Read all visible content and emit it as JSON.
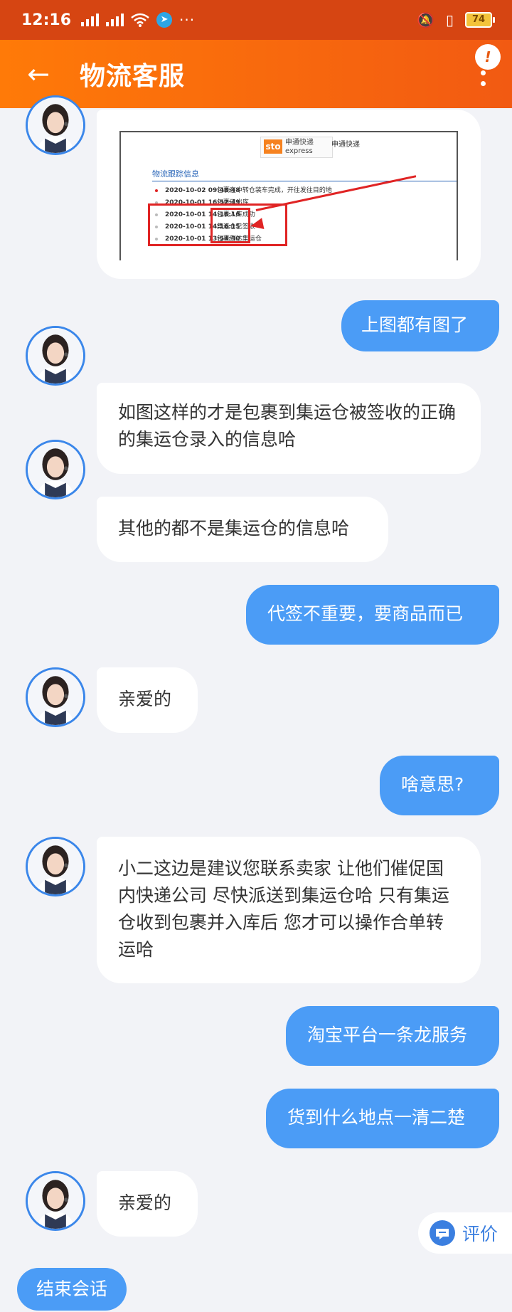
{
  "status_bar": {
    "time": "12:16",
    "battery": "74",
    "more_dots": "···"
  },
  "header": {
    "title": "物流客服",
    "badge": "!"
  },
  "screenshot_image": {
    "brand_name": "申通快递",
    "logo_text": "sto",
    "logo_sub": "申通快递",
    "logo_en": "express",
    "section": "物流跟踪信息",
    "rows": [
      {
        "time": "2020-10-02 09:48:48",
        "text": "包裹在中转仓装车完成，开往发往目的地"
      },
      {
        "time": "2020-10-01 16:52:49",
        "text": "包裹已出库"
      },
      {
        "time": "2020-10-01 14:16:16",
        "text": "包裹入库成功"
      },
      {
        "time": "2020-10-01 14:16:15",
        "text": "集运仓已签收"
      },
      {
        "time": "2020-10-01 13:54:30",
        "text": "包裹到达集运仓"
      }
    ]
  },
  "messages": [
    {
      "side": "right",
      "text": "上图都有图了"
    },
    {
      "side": "left",
      "text": "如图这样的才是包裹到集运仓被签收的正确的集运仓录入的信息哈"
    },
    {
      "side": "left",
      "text": "其他的都不是集运仓的信息哈"
    },
    {
      "side": "right",
      "text": "代签不重要，要商品而已"
    },
    {
      "side": "left",
      "text": "亲爱的"
    },
    {
      "side": "right",
      "text": "啥意思?"
    },
    {
      "side": "left",
      "text": "小二这边是建议您联系卖家 让他们催促国内快递公司 尽快派送到集运仓哈 只有集运仓收到包裹并入库后 您才可以操作合单转运哈"
    },
    {
      "side": "right",
      "text": "淘宝平台一条龙服务"
    },
    {
      "side": "right",
      "text": "货到什么地点一清二楚"
    },
    {
      "side": "left",
      "text": "亲爱的"
    }
  ],
  "evaluate_label": "评价",
  "end_session_label": "结束会话",
  "colors": {
    "header_start": "#ff7a08",
    "header_end": "#f25a12",
    "bubble_right": "#4b9cf6",
    "statusbar": "#d64512"
  },
  "icons": [
    "back-arrow-icon",
    "more-vertical-icon",
    "signal-icon",
    "wifi-icon",
    "telegram-icon",
    "mute-icon",
    "vibrate-icon",
    "battery-icon",
    "evaluate-icon"
  ]
}
